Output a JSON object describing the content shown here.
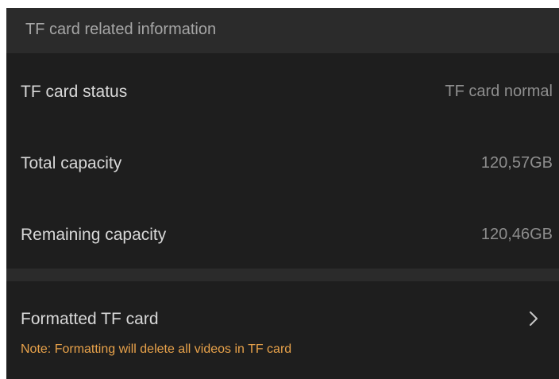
{
  "section": {
    "title": "TF card related information"
  },
  "rows": [
    {
      "label": "TF card status",
      "value": "TF card normal"
    },
    {
      "label": "Total capacity",
      "value": "120,57GB"
    },
    {
      "label": "Remaining capacity",
      "value": "120,46GB"
    }
  ],
  "format": {
    "label": "Formatted TF card",
    "note": "Note: Formatting will delete all videos in TF card",
    "icon": "chevron-right-icon"
  },
  "colors": {
    "background": "#1e1e1e",
    "section_background": "#2b2b2b",
    "note": "#e8a24a"
  }
}
